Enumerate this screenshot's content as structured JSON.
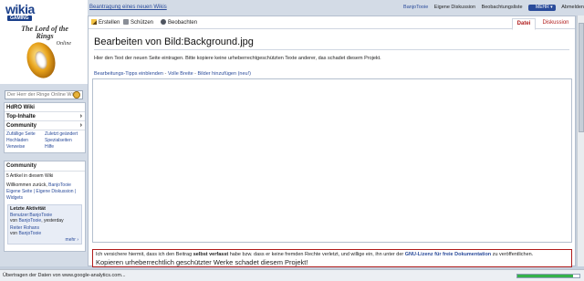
{
  "logo": {
    "brand": "wikia",
    "sub": "GAMING",
    "site_logo_line1": "The Lord of the Rings",
    "site_logo_line2": "Online"
  },
  "search": {
    "placeholder": "Der Herr der Ringe Online Wiki"
  },
  "nav": {
    "items": [
      {
        "label": "HdRO Wiki",
        "chevron": false
      },
      {
        "label": "Top-Inhalte",
        "chevron": true
      },
      {
        "label": "Community",
        "chevron": true
      }
    ],
    "links": [
      "Zufällige Seite",
      "Zuletzt geändert",
      "Hochladen",
      "Spezialseiten",
      "Verweise",
      "Hilfe"
    ]
  },
  "community": {
    "title": "Community",
    "articles": "5 Artikel in diesem Wiki",
    "welcome_prefix": "Willkommen zurück,",
    "username": "BanjoTooie",
    "own_links": "Eigene Seite | Eigene Diskussion |",
    "widgets": "Widgets",
    "activity": {
      "title": "Letzte Aktivität",
      "entries": [
        {
          "page": "Benutzer:BanjoTooie",
          "by_prefix": "von",
          "user": "BanjoTooie",
          "time": ", yesterday"
        },
        {
          "page": "Reiter Rohans",
          "by_prefix": "von",
          "user": "BanjoTooie",
          "time": ""
        }
      ],
      "more": "mehr ›"
    }
  },
  "topbar": {
    "new_wiki": "Beantragung eines neuen Wikis",
    "user": "BanjoTooie",
    "discussion": "Eigene Diskussion",
    "watchlist": "Beobachtungsliste",
    "more": "MEHR",
    "logout": "Abmelden"
  },
  "actions": {
    "create": "Erstellen",
    "protect": "Schützen",
    "watch": "Beobachten",
    "tab_file": "Datei",
    "tab_discussion": "Diskussion"
  },
  "page": {
    "title": "Bearbeiten von Bild:Background.jpg",
    "intro": "Hier den Text der neuen Seite eintragen. Bitte kopiere keine urheberrechtgeschützten Texte anderer, das schadet diesem Projekt.",
    "tips_label": "Bearbeitungs-Tipps einblenden",
    "tips_sep1": " - ",
    "tips_width": "Volle Breite",
    "tips_sep2": " - ",
    "tips_images": "Bilder hinzufügen (neu!)",
    "editor_value": "",
    "license_1a": "Ich versichere hiermit, dass ich den Beitrag ",
    "license_1b": "selbst verfasst",
    "license_1c": " habe bzw. dass er keine fremden Rechte verletzt, und willige ein, ihn unter der ",
    "license_1d": "GNU-Lizenz für freie Dokumentation",
    "license_1e": " zu veröffentlichen.",
    "license_2": "Kopieren urheberrechtlich geschützter Werke schadet diesem Projekt!"
  },
  "status": {
    "text": "Übertragen der Daten von www.google-analytics.com...",
    "progress": 0.9
  },
  "colors": {
    "accent": "#2a4b9a",
    "tab_red": "#b01c1c",
    "progress_green": "#35b24a"
  }
}
